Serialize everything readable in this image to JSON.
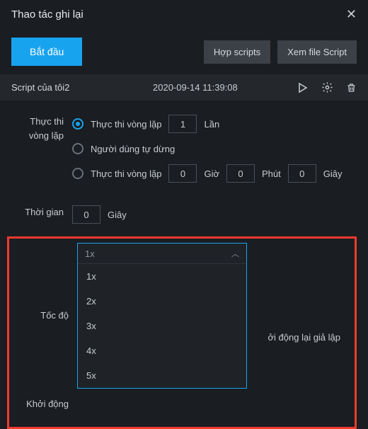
{
  "titlebar": {
    "title": "Thao tác ghi lại"
  },
  "toolbar": {
    "start": "Bắt đầu",
    "merge": "Hợp scripts",
    "view": "Xem file Script"
  },
  "script": {
    "name": "Script của tôi2",
    "date": "2020-09-14 11:39:08"
  },
  "form": {
    "loop_label": "Thực thi vòng lặp",
    "radio1_text": "Thực thi vòng lặp",
    "radio1_value": "1",
    "radio1_unit": "Lần",
    "radio2_text": "Người dùng tự dừng",
    "radio3_text": "Thực thi vòng lặp",
    "hours": "0",
    "hours_unit": "Giờ",
    "minutes": "0",
    "minutes_unit": "Phút",
    "seconds": "0",
    "seconds_unit": "Giây",
    "delay_label": "Thời gian",
    "delay_value": "0",
    "delay_unit": "Giây",
    "speed_label": "Tốc độ",
    "speed_selected": "1x",
    "speed_options": [
      "1x",
      "2x",
      "3x",
      "4x",
      "5x"
    ],
    "start_label": "Khởi động",
    "behind_text": "ởi động lại giả lập"
  }
}
